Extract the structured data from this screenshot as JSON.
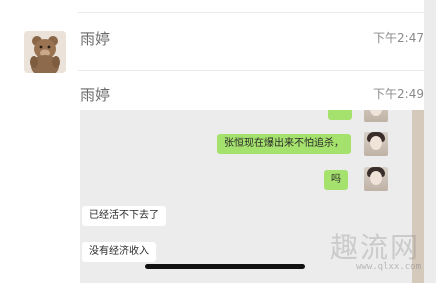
{
  "messages": [
    {
      "sender": "雨婷",
      "time": "下午2:47"
    },
    {
      "sender": "雨婷",
      "time": "下午2:49"
    }
  ],
  "screenshot_chat": {
    "outgoing": [
      "张恒现在爆出来不怕追杀，",
      "吗"
    ],
    "incoming": [
      "已经活不下去了",
      "没有经济收入"
    ]
  },
  "watermark": {
    "title": "趣流网",
    "url": "www.qlxx.com"
  },
  "colors": {
    "outgoing_bubble": "#a5e16d",
    "incoming_bubble": "#ffffff"
  }
}
